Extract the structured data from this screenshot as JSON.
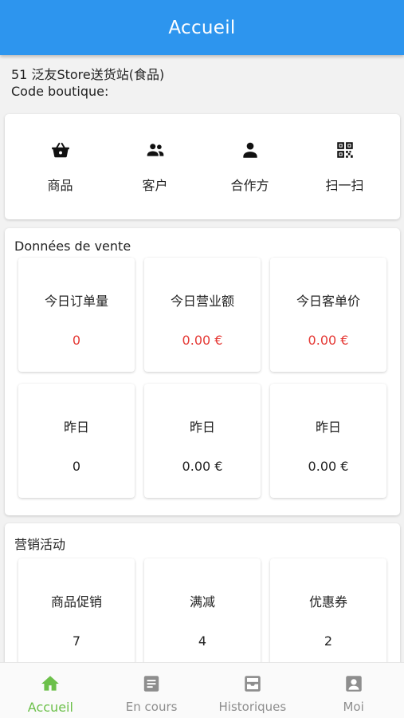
{
  "app_bar": {
    "title": "Accueil"
  },
  "store": {
    "name": "51 泛友Store送货站(食品)",
    "code_label": "Code boutique:"
  },
  "quick_actions": [
    {
      "label": "商品",
      "icon": "basket-icon"
    },
    {
      "label": "客户",
      "icon": "people-icon"
    },
    {
      "label": "合作方",
      "icon": "person-icon"
    },
    {
      "label": "扫一扫",
      "icon": "qr-code-icon"
    }
  ],
  "sales": {
    "title": "Données de vente",
    "today": [
      {
        "label": "今日订单量",
        "value": "0"
      },
      {
        "label": "今日营业额",
        "value": "0.00 €"
      },
      {
        "label": "今日客单价",
        "value": "0.00 €"
      }
    ],
    "yesterday": [
      {
        "label": "昨日",
        "value": "0"
      },
      {
        "label": "昨日",
        "value": "0.00 €"
      },
      {
        "label": "昨日",
        "value": "0.00 €"
      }
    ]
  },
  "marketing": {
    "title": "营销活动",
    "items": [
      {
        "label": "商品促销",
        "value": "7"
      },
      {
        "label": "满减",
        "value": "4"
      },
      {
        "label": "优惠券",
        "value": "2"
      }
    ]
  },
  "tabs": [
    {
      "label": "Accueil",
      "icon": "home-icon",
      "active": true
    },
    {
      "label": "En cours",
      "icon": "document-icon",
      "active": false
    },
    {
      "label": "Historiques",
      "icon": "archive-icon",
      "active": false
    },
    {
      "label": "Moi",
      "icon": "account-icon",
      "active": false
    }
  ],
  "colors": {
    "app_bar": "#2d95ee",
    "accent_red": "#e53935",
    "active_tab": "#6cc04a",
    "inactive_tab": "#8e8e8e"
  }
}
